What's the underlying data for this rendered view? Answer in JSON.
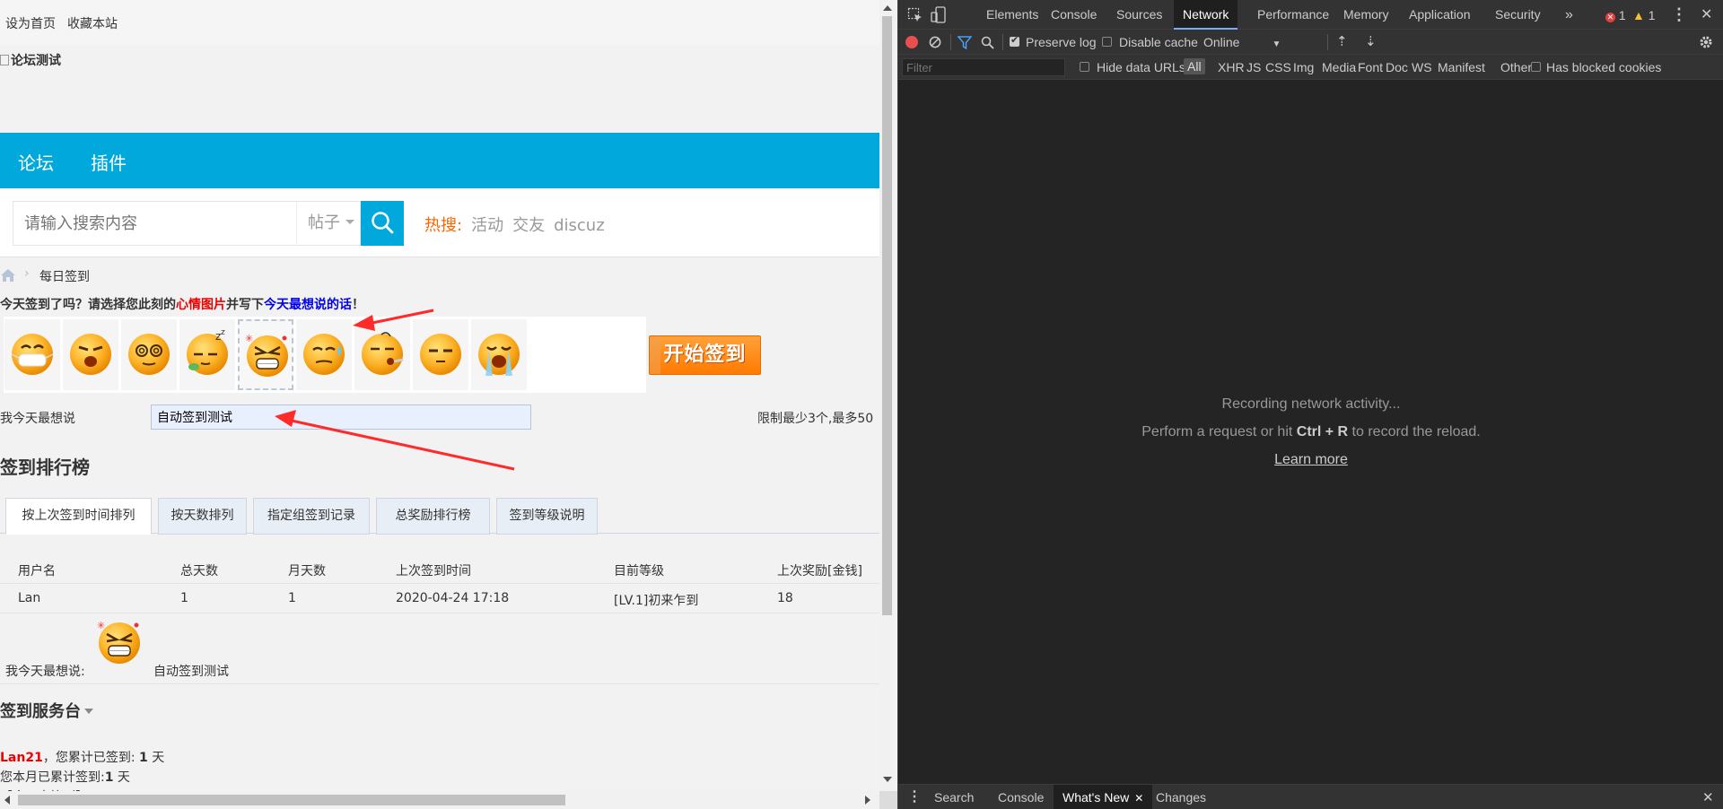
{
  "page": {
    "topbar": {
      "set_home": "设为首页",
      "bookmark": "收藏本站"
    },
    "logo_alt": "论坛测试",
    "nav": [
      "论坛",
      "插件"
    ],
    "search": {
      "placeholder": "请输入搜索内容",
      "type": "帖子",
      "hot_label": "热搜:",
      "hot_links": [
        "活动",
        "交友",
        "discuz"
      ]
    },
    "breadcrumb": {
      "current": "每日签到",
      "separator": "›"
    },
    "prompt": {
      "p1": "今天签到了吗？请选择您此刻的",
      "p2": "心情图片",
      "p3": "并写下",
      "p4": "今天最想说的话",
      "p5": "！"
    },
    "moods": [
      "mask",
      "tired",
      "dizzy",
      "sleepy",
      "angry",
      "sweat",
      "sick",
      "calm",
      "crying"
    ],
    "selected_mood_index": 4,
    "start_button": "开始签到",
    "say": {
      "label": "我今天最想说",
      "value": "自动签到测试",
      "limit": "限制最少3个,最多50"
    },
    "rank": {
      "title": "签到排行榜",
      "tabs": [
        "按上次签到时间排列",
        "按天数排列",
        "指定组签到记录",
        "总奖励排行榜",
        "签到等级说明"
      ],
      "active_tab": 0,
      "columns": [
        "用户名",
        "总天数",
        "月天数",
        "上次签到时间",
        "目前等级",
        "上次奖励[金钱]"
      ],
      "rows": [
        [
          "Lan",
          "1",
          "1",
          "2020-04-24 17:18",
          "[LV.1]初来乍到",
          "18"
        ]
      ],
      "today_label": "我今天最想说:",
      "today_value": "自动签到测试"
    },
    "service": {
      "title": "签到服务台",
      "user": "Lan21",
      "line1_mid": "，您累计已签到: ",
      "total_days": "1",
      "day_unit": " 天",
      "line2": "您本月已累计签到:",
      "month_days": "1",
      "status": "【今天未签到】"
    }
  },
  "devtools": {
    "tabs": [
      "Elements",
      "Console",
      "Sources",
      "Network",
      "Performance",
      "Memory",
      "Application",
      "Security"
    ],
    "active_tab": "Network",
    "errors": "1",
    "warnings": "1",
    "toolbar": {
      "preserve_log": "Preserve log",
      "disable_cache": "Disable cache",
      "throttle": "Online"
    },
    "filter": {
      "placeholder": "Filter",
      "hide_data_urls": "Hide data URLs",
      "types": [
        "All",
        "XHR",
        "JS",
        "CSS",
        "Img",
        "Media",
        "Font",
        "Doc",
        "WS",
        "Manifest",
        "Other"
      ],
      "blocked_cookies": "Has blocked cookies"
    },
    "empty": {
      "line1": "Recording network activity...",
      "line2_pre": "Perform a request or hit ",
      "line2_key": "Ctrl + R",
      "line2_post": " to record the reload.",
      "learn_more": "Learn more"
    },
    "drawer_tabs": [
      "Search",
      "Console",
      "What's New",
      "Changes"
    ],
    "drawer_active": "What's New"
  },
  "colors": {
    "nav_bg": "#00a8dc",
    "hot_label": "#ff6600",
    "devtools_bg": "#242424",
    "arrow": "#ff2a2a"
  }
}
